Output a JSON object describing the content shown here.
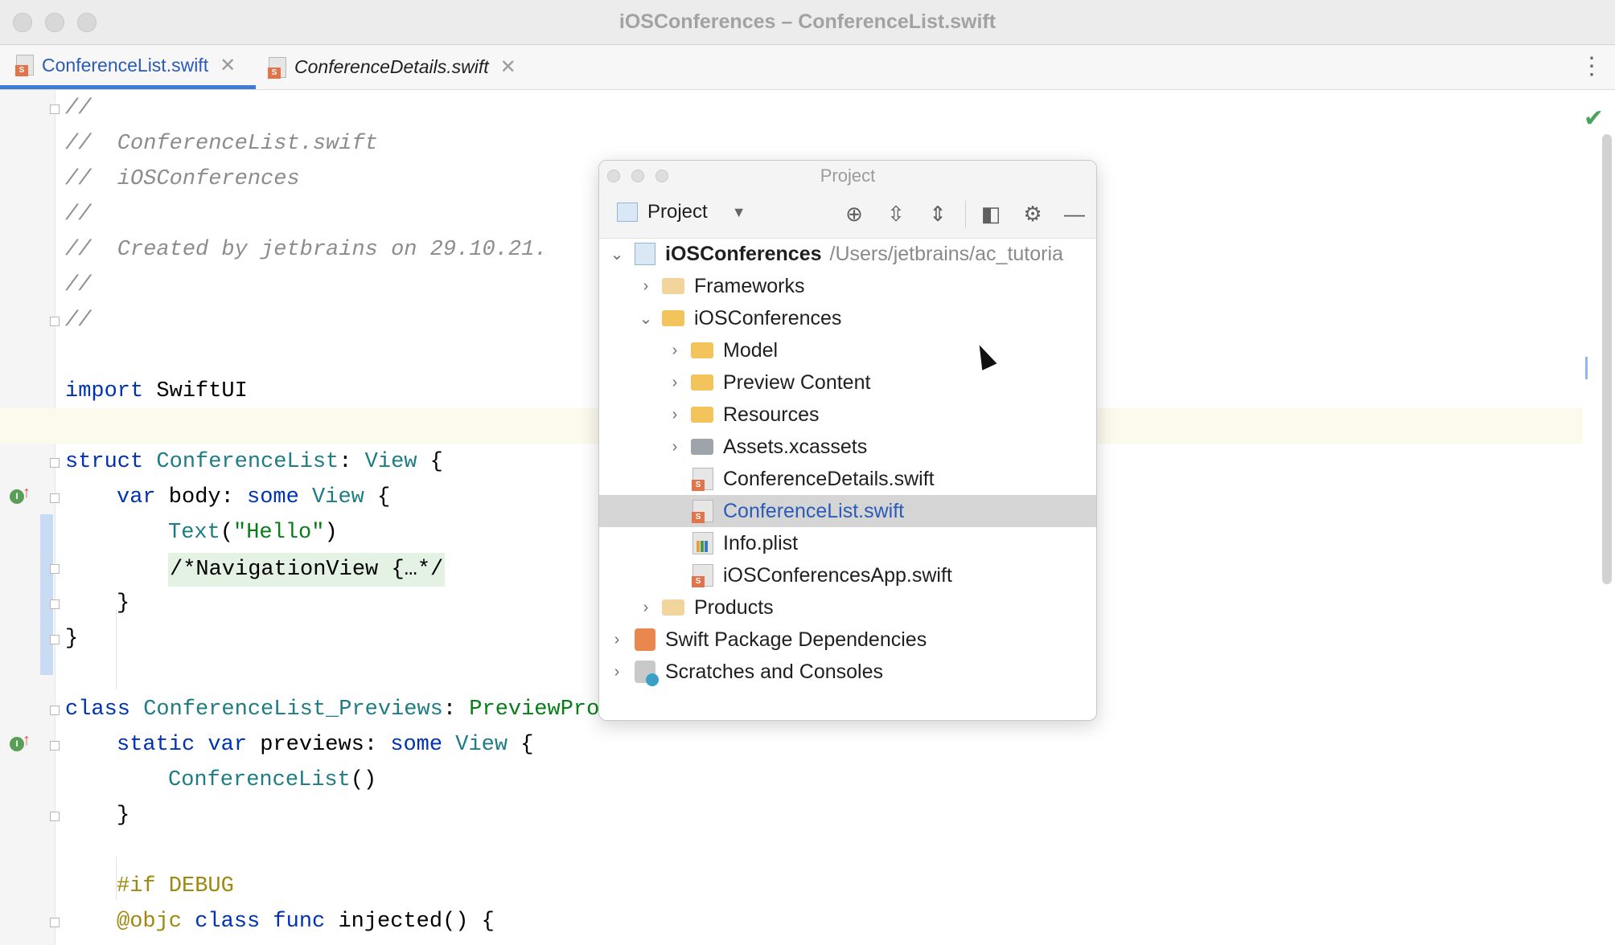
{
  "window": {
    "title": "iOSConferences – ConferenceList.swift"
  },
  "tabs": [
    {
      "label": "ConferenceList.swift",
      "active": true
    },
    {
      "label": "ConferenceDetails.swift",
      "active": false
    }
  ],
  "code": {
    "l1": "//",
    "l2": "//  ConferenceList.swift",
    "l3": "//  iOSConferences",
    "l4": "//",
    "l5": "//  Created by jetbrains on 29.10.21.",
    "l6": "//",
    "l7": "//",
    "l9_kw": "import",
    "l9_rest": " SwiftUI",
    "l11_kw": "struct",
    "l11_ty": " ConferenceList",
    "l11_colon": ": ",
    "l11_ty2": "View",
    "l11_end": " {",
    "l12_kw": "var",
    "l12_body": " body: ",
    "l12_kw2": "some",
    "l12_ty": " View",
    "l12_end": " {",
    "l13_ty": "Text",
    "l13_p1": "(",
    "l13_st": "\"Hello\"",
    "l13_p2": ")",
    "l14_fold": "/*NavigationView {…*/",
    "l15": "}",
    "l16": "}",
    "l18_kw": "class",
    "l18_ty": " ConferenceList_Previews",
    "l18_colon": ": ",
    "l18_ty2": "PreviewProv",
    "l19_kw": "static var",
    "l19_rest": " previews: ",
    "l19_kw2": "some",
    "l19_ty": " View",
    "l19_end": " {",
    "l20_ty": "ConferenceList",
    "l20_end": "()",
    "l21": "}",
    "l23_pp": "#if DEBUG",
    "l24_pp": "@objc",
    "l24_kw": " class func",
    "l24_rest": " injected() {"
  },
  "project_popup": {
    "title": "Project",
    "view_selector": "Project",
    "toolbar_icons": [
      "locate-icon",
      "expand-all-icon",
      "collapse-all-icon",
      "layout-icon",
      "gear-icon",
      "minimize-icon"
    ],
    "tree": [
      {
        "label": "iOSConferences",
        "path": "/Users/jetbrains/ac_tutoria",
        "icon": "project-icon",
        "expanded": true
      },
      {
        "label": "Frameworks",
        "icon": "folder-icon",
        "expanded": false
      },
      {
        "label": "iOSConferences",
        "icon": "folder-icon",
        "expanded": true
      },
      {
        "label": "Model",
        "icon": "folder-icon",
        "expanded": false
      },
      {
        "label": "Preview Content",
        "icon": "folder-icon",
        "expanded": false
      },
      {
        "label": "Resources",
        "icon": "folder-icon",
        "expanded": false
      },
      {
        "label": "Assets.xcassets",
        "icon": "assets-folder-icon",
        "expanded": false
      },
      {
        "label": "ConferenceDetails.swift",
        "icon": "swift-file-icon"
      },
      {
        "label": "ConferenceList.swift",
        "icon": "swift-file-icon",
        "selected": true
      },
      {
        "label": "Info.plist",
        "icon": "plist-file-icon"
      },
      {
        "label": "iOSConferencesApp.swift",
        "icon": "swift-file-icon"
      },
      {
        "label": "Products",
        "icon": "folder-icon",
        "expanded": false
      },
      {
        "label": "Swift Package Dependencies",
        "icon": "package-icon",
        "expanded": false
      },
      {
        "label": "Scratches and Consoles",
        "icon": "scratches-icon",
        "expanded": false
      }
    ]
  },
  "colors": {
    "accent": "#3d7cd6",
    "keyword": "#0033b3",
    "type": "#1d7c84",
    "string": "#067d17",
    "comment": "#8c8c8c",
    "selection": "#d5d5d5"
  }
}
